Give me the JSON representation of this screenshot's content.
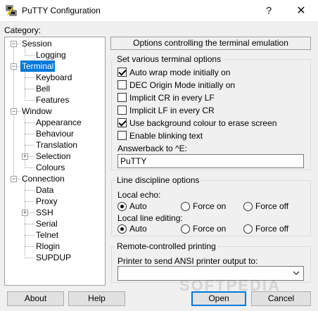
{
  "window": {
    "title": "PuTTY Configuration",
    "help_glyph": "?",
    "close_glyph": "✕"
  },
  "category": {
    "label": "Category:",
    "items": [
      {
        "label": "Session",
        "level": 0,
        "expander": "minus"
      },
      {
        "label": "Logging",
        "level": 1
      },
      {
        "label": "Terminal",
        "level": 0,
        "expander": "minus",
        "selected": true
      },
      {
        "label": "Keyboard",
        "level": 1
      },
      {
        "label": "Bell",
        "level": 1
      },
      {
        "label": "Features",
        "level": 1
      },
      {
        "label": "Window",
        "level": 0,
        "expander": "minus"
      },
      {
        "label": "Appearance",
        "level": 1
      },
      {
        "label": "Behaviour",
        "level": 1
      },
      {
        "label": "Translation",
        "level": 1
      },
      {
        "label": "Selection",
        "level": 1,
        "expander": "plus"
      },
      {
        "label": "Colours",
        "level": 1
      },
      {
        "label": "Connection",
        "level": 0,
        "expander": "minus"
      },
      {
        "label": "Data",
        "level": 1
      },
      {
        "label": "Proxy",
        "level": 1
      },
      {
        "label": "SSH",
        "level": 1,
        "expander": "plus"
      },
      {
        "label": "Serial",
        "level": 1
      },
      {
        "label": "Telnet",
        "level": 1
      },
      {
        "label": "Rlogin",
        "level": 1
      },
      {
        "label": "SUPDUP",
        "level": 1
      }
    ]
  },
  "panel": {
    "header": "Options controlling the terminal emulation",
    "general": {
      "title": "Set various terminal options",
      "options": [
        {
          "label": "Auto wrap mode initially on",
          "checked": true
        },
        {
          "label": "DEC Origin Mode initially on",
          "checked": false
        },
        {
          "label": "Implicit CR in every LF",
          "checked": false
        },
        {
          "label": "Implicit LF in every CR",
          "checked": false
        },
        {
          "label": "Use background colour to erase screen",
          "checked": true
        },
        {
          "label": "Enable blinking text",
          "checked": false
        }
      ],
      "answerback_label": "Answerback to ^E:",
      "answerback_value": "PuTTY"
    },
    "line_discipline": {
      "title": "Line discipline options",
      "local_echo_label": "Local echo:",
      "local_editing_label": "Local line editing:",
      "choices": [
        "Auto",
        "Force on",
        "Force off"
      ],
      "local_echo_selected": "Auto",
      "local_editing_selected": "Auto"
    },
    "printing": {
      "title": "Remote-controlled printing",
      "printer_label": "Printer to send ANSI printer output to:",
      "printer_value": ""
    }
  },
  "buttons": {
    "about": "About",
    "help": "Help",
    "open": "Open",
    "cancel": "Cancel"
  },
  "watermark": "SOFTPEDIA",
  "colors": {
    "selection": "#0078d7",
    "window_bg": "#f0f0f0"
  }
}
